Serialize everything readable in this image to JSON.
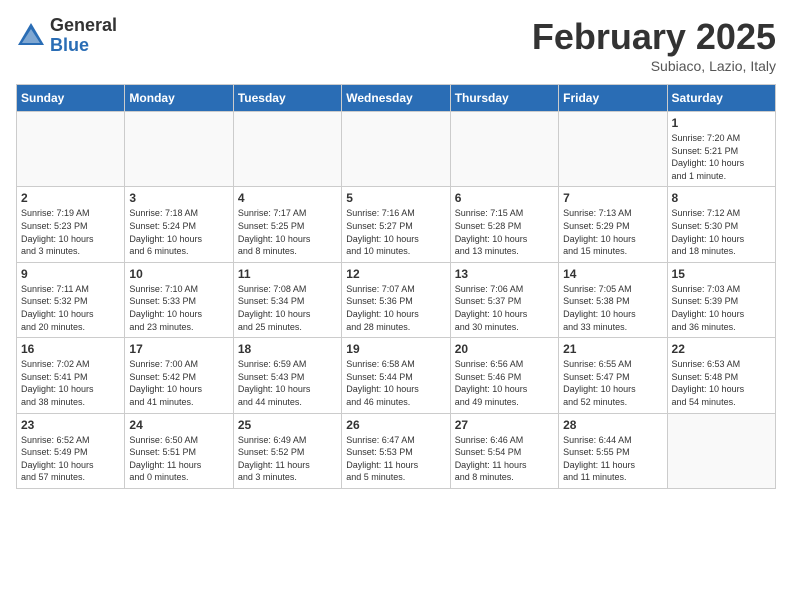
{
  "header": {
    "logo_general": "General",
    "logo_blue": "Blue",
    "month_title": "February 2025",
    "location": "Subiaco, Lazio, Italy"
  },
  "weekdays": [
    "Sunday",
    "Monday",
    "Tuesday",
    "Wednesday",
    "Thursday",
    "Friday",
    "Saturday"
  ],
  "weeks": [
    [
      {
        "day": "",
        "info": ""
      },
      {
        "day": "",
        "info": ""
      },
      {
        "day": "",
        "info": ""
      },
      {
        "day": "",
        "info": ""
      },
      {
        "day": "",
        "info": ""
      },
      {
        "day": "",
        "info": ""
      },
      {
        "day": "1",
        "info": "Sunrise: 7:20 AM\nSunset: 5:21 PM\nDaylight: 10 hours\nand 1 minute."
      }
    ],
    [
      {
        "day": "2",
        "info": "Sunrise: 7:19 AM\nSunset: 5:23 PM\nDaylight: 10 hours\nand 3 minutes."
      },
      {
        "day": "3",
        "info": "Sunrise: 7:18 AM\nSunset: 5:24 PM\nDaylight: 10 hours\nand 6 minutes."
      },
      {
        "day": "4",
        "info": "Sunrise: 7:17 AM\nSunset: 5:25 PM\nDaylight: 10 hours\nand 8 minutes."
      },
      {
        "day": "5",
        "info": "Sunrise: 7:16 AM\nSunset: 5:27 PM\nDaylight: 10 hours\nand 10 minutes."
      },
      {
        "day": "6",
        "info": "Sunrise: 7:15 AM\nSunset: 5:28 PM\nDaylight: 10 hours\nand 13 minutes."
      },
      {
        "day": "7",
        "info": "Sunrise: 7:13 AM\nSunset: 5:29 PM\nDaylight: 10 hours\nand 15 minutes."
      },
      {
        "day": "8",
        "info": "Sunrise: 7:12 AM\nSunset: 5:30 PM\nDaylight: 10 hours\nand 18 minutes."
      }
    ],
    [
      {
        "day": "9",
        "info": "Sunrise: 7:11 AM\nSunset: 5:32 PM\nDaylight: 10 hours\nand 20 minutes."
      },
      {
        "day": "10",
        "info": "Sunrise: 7:10 AM\nSunset: 5:33 PM\nDaylight: 10 hours\nand 23 minutes."
      },
      {
        "day": "11",
        "info": "Sunrise: 7:08 AM\nSunset: 5:34 PM\nDaylight: 10 hours\nand 25 minutes."
      },
      {
        "day": "12",
        "info": "Sunrise: 7:07 AM\nSunset: 5:36 PM\nDaylight: 10 hours\nand 28 minutes."
      },
      {
        "day": "13",
        "info": "Sunrise: 7:06 AM\nSunset: 5:37 PM\nDaylight: 10 hours\nand 30 minutes."
      },
      {
        "day": "14",
        "info": "Sunrise: 7:05 AM\nSunset: 5:38 PM\nDaylight: 10 hours\nand 33 minutes."
      },
      {
        "day": "15",
        "info": "Sunrise: 7:03 AM\nSunset: 5:39 PM\nDaylight: 10 hours\nand 36 minutes."
      }
    ],
    [
      {
        "day": "16",
        "info": "Sunrise: 7:02 AM\nSunset: 5:41 PM\nDaylight: 10 hours\nand 38 minutes."
      },
      {
        "day": "17",
        "info": "Sunrise: 7:00 AM\nSunset: 5:42 PM\nDaylight: 10 hours\nand 41 minutes."
      },
      {
        "day": "18",
        "info": "Sunrise: 6:59 AM\nSunset: 5:43 PM\nDaylight: 10 hours\nand 44 minutes."
      },
      {
        "day": "19",
        "info": "Sunrise: 6:58 AM\nSunset: 5:44 PM\nDaylight: 10 hours\nand 46 minutes."
      },
      {
        "day": "20",
        "info": "Sunrise: 6:56 AM\nSunset: 5:46 PM\nDaylight: 10 hours\nand 49 minutes."
      },
      {
        "day": "21",
        "info": "Sunrise: 6:55 AM\nSunset: 5:47 PM\nDaylight: 10 hours\nand 52 minutes."
      },
      {
        "day": "22",
        "info": "Sunrise: 6:53 AM\nSunset: 5:48 PM\nDaylight: 10 hours\nand 54 minutes."
      }
    ],
    [
      {
        "day": "23",
        "info": "Sunrise: 6:52 AM\nSunset: 5:49 PM\nDaylight: 10 hours\nand 57 minutes."
      },
      {
        "day": "24",
        "info": "Sunrise: 6:50 AM\nSunset: 5:51 PM\nDaylight: 11 hours\nand 0 minutes."
      },
      {
        "day": "25",
        "info": "Sunrise: 6:49 AM\nSunset: 5:52 PM\nDaylight: 11 hours\nand 3 minutes."
      },
      {
        "day": "26",
        "info": "Sunrise: 6:47 AM\nSunset: 5:53 PM\nDaylight: 11 hours\nand 5 minutes."
      },
      {
        "day": "27",
        "info": "Sunrise: 6:46 AM\nSunset: 5:54 PM\nDaylight: 11 hours\nand 8 minutes."
      },
      {
        "day": "28",
        "info": "Sunrise: 6:44 AM\nSunset: 5:55 PM\nDaylight: 11 hours\nand 11 minutes."
      },
      {
        "day": "",
        "info": ""
      }
    ]
  ]
}
